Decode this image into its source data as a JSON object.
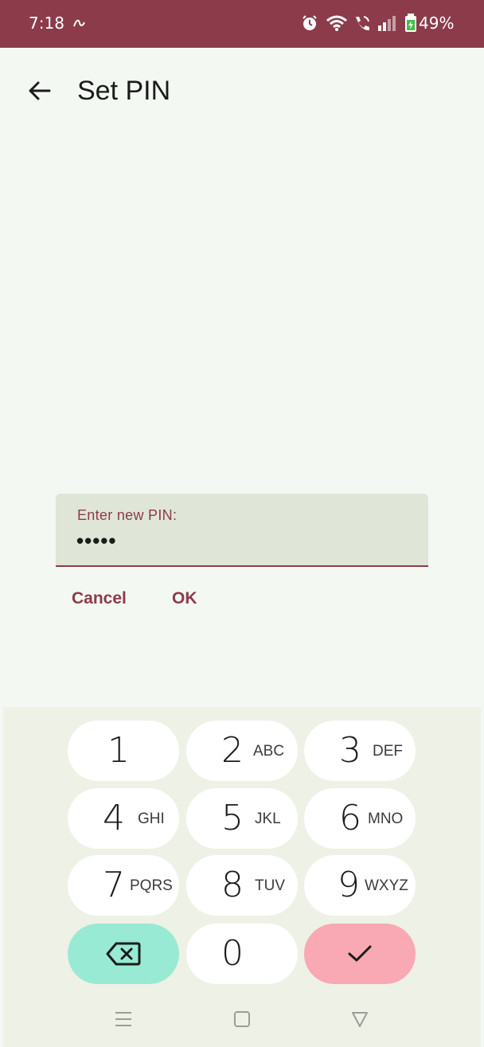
{
  "status_bar": {
    "time": "7:18",
    "battery": "49%"
  },
  "header": {
    "title": "Set PIN"
  },
  "pin_dialog": {
    "label": "Enter new PIN:",
    "value": "•••••",
    "cancel_label": "Cancel",
    "ok_label": "OK"
  },
  "keypad": {
    "keys": [
      {
        "digit": "1",
        "letters": ""
      },
      {
        "digit": "2",
        "letters": "ABC"
      },
      {
        "digit": "3",
        "letters": "DEF"
      },
      {
        "digit": "4",
        "letters": "GHI"
      },
      {
        "digit": "5",
        "letters": "JKL"
      },
      {
        "digit": "6",
        "letters": "MNO"
      },
      {
        "digit": "7",
        "letters": "PQRS"
      },
      {
        "digit": "8",
        "letters": "TUV"
      },
      {
        "digit": "9",
        "letters": "WXYZ"
      },
      {
        "digit": "0",
        "letters": ""
      }
    ],
    "delete_icon": "backspace-icon",
    "done_icon": "checkmark-icon"
  },
  "colors": {
    "accent": "#8c3b4a",
    "background": "#f4f8f3",
    "field_bg": "#dfe5d7",
    "keyboard_bg": "#eef1e6",
    "delete_key": "#98ead4",
    "done_key": "#f8a9b3"
  },
  "nav_bar": {
    "icons": [
      "menu-icon",
      "home-icon",
      "back-triangle-icon"
    ]
  }
}
